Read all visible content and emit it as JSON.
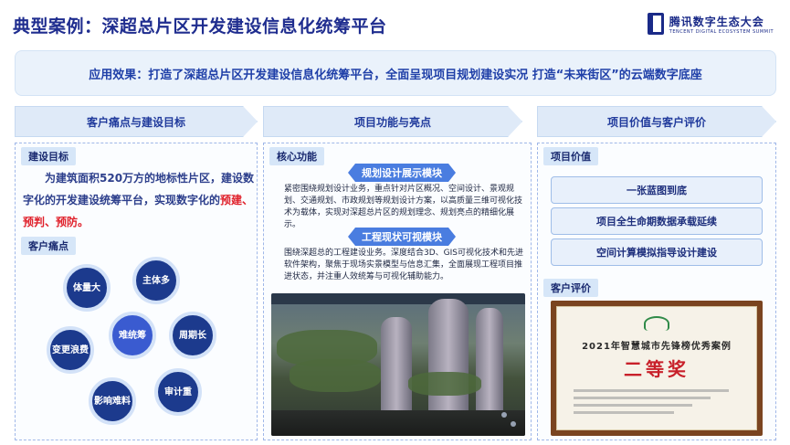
{
  "header": {
    "title": "典型案例：深超总片区开发建设信息化统筹平台",
    "logo_cn": "腾讯数字生态大会",
    "logo_en": "TENCENT DIGITAL ECOSYSTEM SUMMIT"
  },
  "banner": {
    "text": "应用效果：打造了深超总片区开发建设信息化统筹平台，全面呈现项目规划建设实况   打造“未来街区”的云端数字底座"
  },
  "columns": [
    {
      "label": "客户痛点与建设目标"
    },
    {
      "label": "项目功能与亮点"
    },
    {
      "label": "项目价值与客户评价"
    }
  ],
  "left": {
    "goal_tag": "建设目标",
    "goal_text_1": "为建筑面积520万方的地标性片区，建设数字化的开发建设统筹平台，实现数字化的",
    "goal_text_red": "预建、预判、预防。",
    "pain_tag": "客户痛点",
    "pain_points": [
      "体量大",
      "主体多",
      "变更浪费",
      "难统筹",
      "周期长",
      "影响难料",
      "审计重"
    ]
  },
  "middle": {
    "core_tag": "核心功能",
    "module1_title": "规划设计展示模块",
    "module1_text": "紧密围绕规划设计业务，重点针对片区概况、空间设计、景观规划、交通规划、市政规划等规划设计方案，以高质量三维可视化技术为载体，实现对深超总片区的规划理念、规划亮点的精细化展示。",
    "module2_title": "工程现状可视模块",
    "module2_text": "围绕深超总的工程建设业务。深度结合3D、GIS可视化技术和先进软件架构，聚焦于现场实景模型与信息汇集，全面展现工程项目推进状态，并注重人效统筹与可视化辅助能力。"
  },
  "right": {
    "value_tag": "项目价值",
    "values": [
      "一张蓝图到底",
      "项目全生命期数据承载延续",
      "空间计算模拟指导设计建设"
    ],
    "eval_tag": "客户评价",
    "cert_year": "2021年智慧城市先锋榜优秀案例",
    "cert_award": "二等奖"
  },
  "colors": {
    "title": "#1f2d8f",
    "accent_red": "#e0212b",
    "bubble_dark": "#1c3a8d",
    "module_blue": "#4a7de0"
  }
}
